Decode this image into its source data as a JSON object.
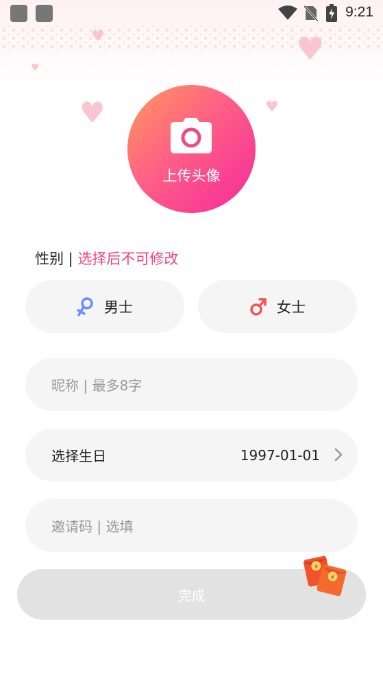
{
  "status_bar": {
    "time": "9:21"
  },
  "avatar": {
    "label": "上传头像"
  },
  "gender": {
    "title": "性别 | ",
    "hint": "选择后不可修改",
    "male_label": "男士",
    "female_label": "女士",
    "male_color": "#6b8cff",
    "female_color": "#f25555"
  },
  "nickname": {
    "placeholder": "昵称 | 最多8字"
  },
  "birthday": {
    "label": "选择生日",
    "value": "1997-01-01"
  },
  "invite": {
    "placeholder": "邀请码 | 选填"
  },
  "submit": {
    "label": "完成"
  },
  "colors": {
    "accent": "#f0437f",
    "avatar_start": "#ff9a5c",
    "avatar_end": "#f42a9c"
  }
}
